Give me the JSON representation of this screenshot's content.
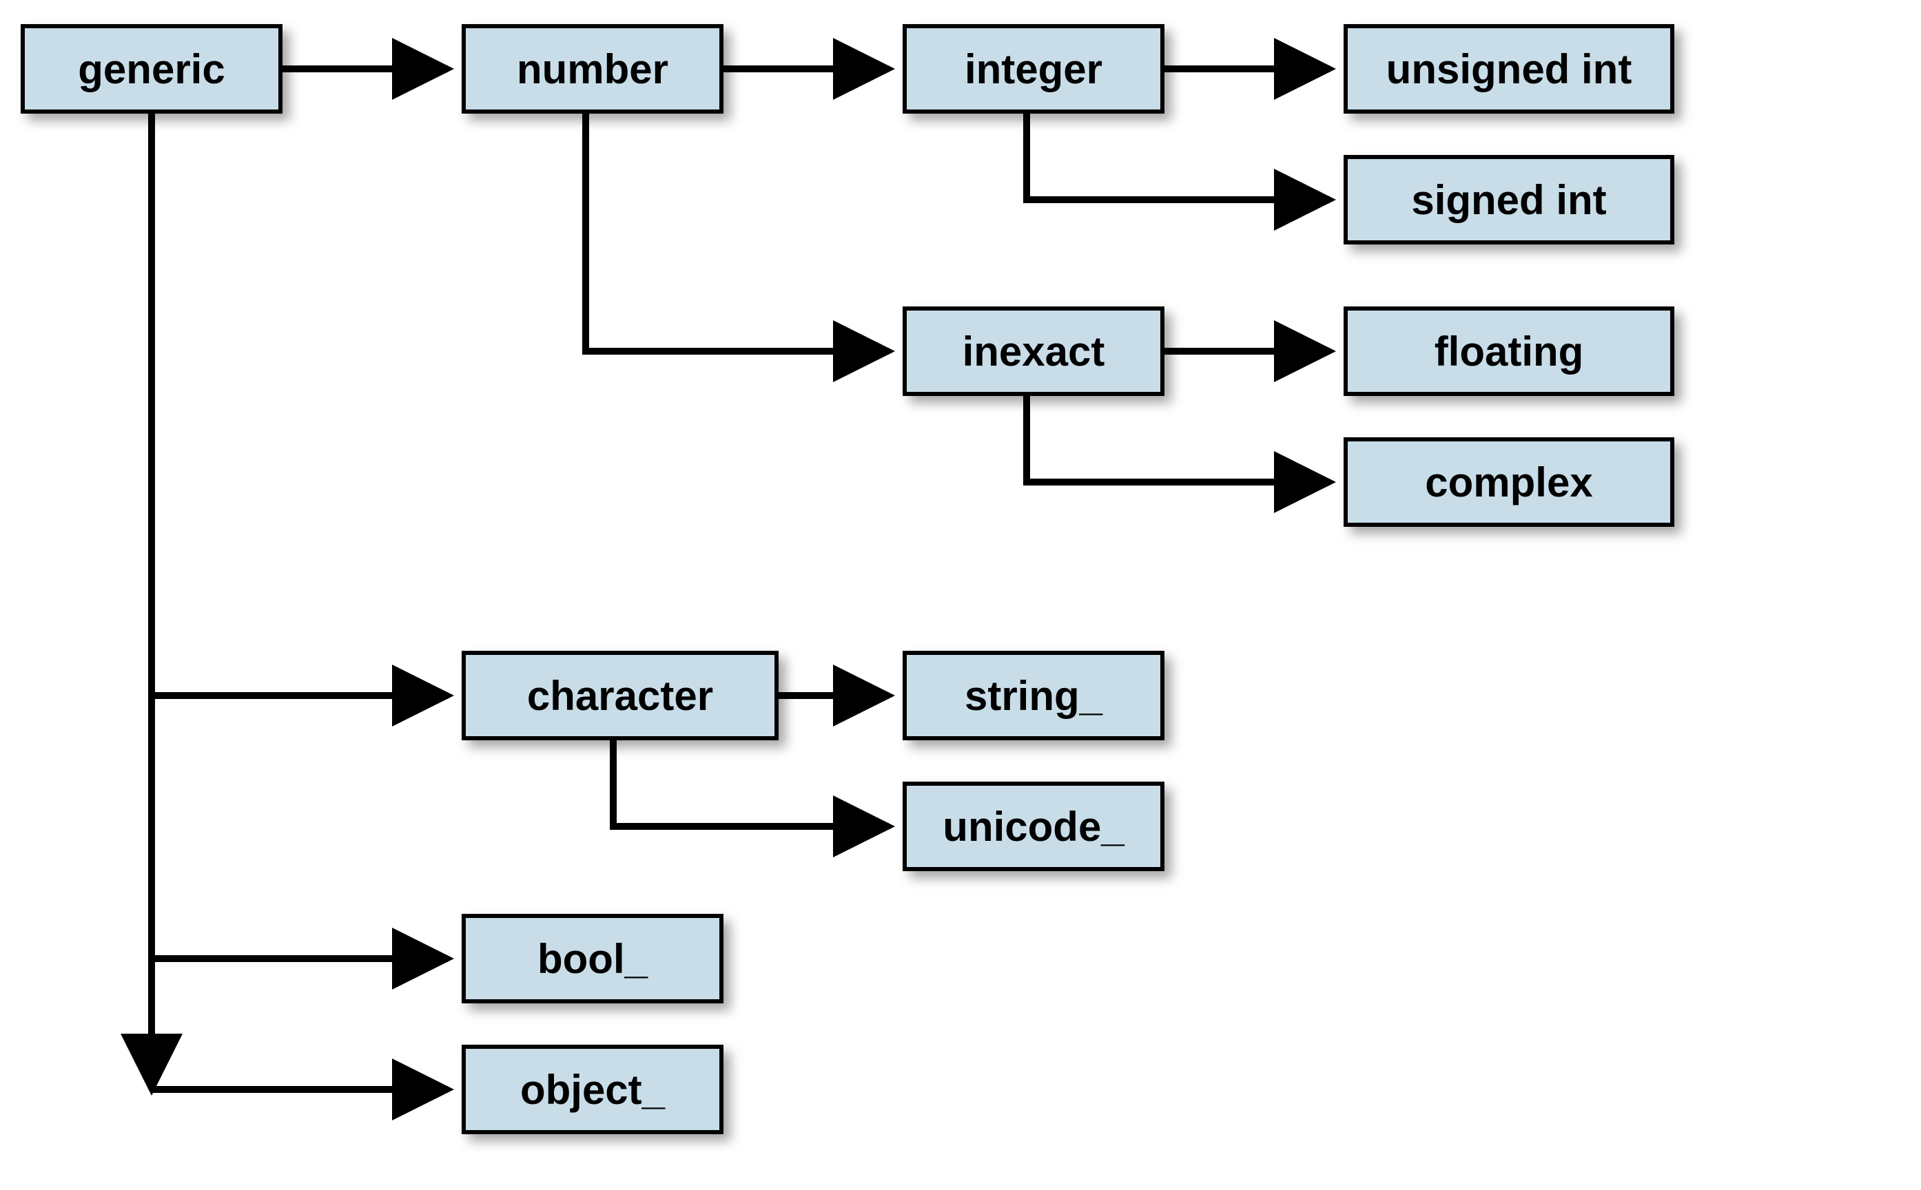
{
  "diagram": {
    "nodes": {
      "generic": {
        "label": "generic"
      },
      "number": {
        "label": "number"
      },
      "integer": {
        "label": "integer"
      },
      "unsigned_int": {
        "label": "unsigned int"
      },
      "signed_int": {
        "label": "signed int"
      },
      "inexact": {
        "label": "inexact"
      },
      "floating": {
        "label": "floating"
      },
      "complex": {
        "label": "complex"
      },
      "character": {
        "label": "character"
      },
      "string": {
        "label": "string_"
      },
      "unicode": {
        "label": "unicode_"
      },
      "bool": {
        "label": "bool_"
      },
      "object": {
        "label": "object_"
      }
    },
    "edges": [
      [
        "generic",
        "number"
      ],
      [
        "generic",
        "character"
      ],
      [
        "generic",
        "bool"
      ],
      [
        "generic",
        "object"
      ],
      [
        "number",
        "integer"
      ],
      [
        "number",
        "inexact"
      ],
      [
        "integer",
        "unsigned_int"
      ],
      [
        "integer",
        "signed_int"
      ],
      [
        "inexact",
        "floating"
      ],
      [
        "inexact",
        "complex"
      ],
      [
        "character",
        "string"
      ],
      [
        "character",
        "unicode"
      ]
    ],
    "style": {
      "node_fill": "#c8dde8",
      "node_border": "#000000",
      "arrow_color": "#000000"
    }
  }
}
